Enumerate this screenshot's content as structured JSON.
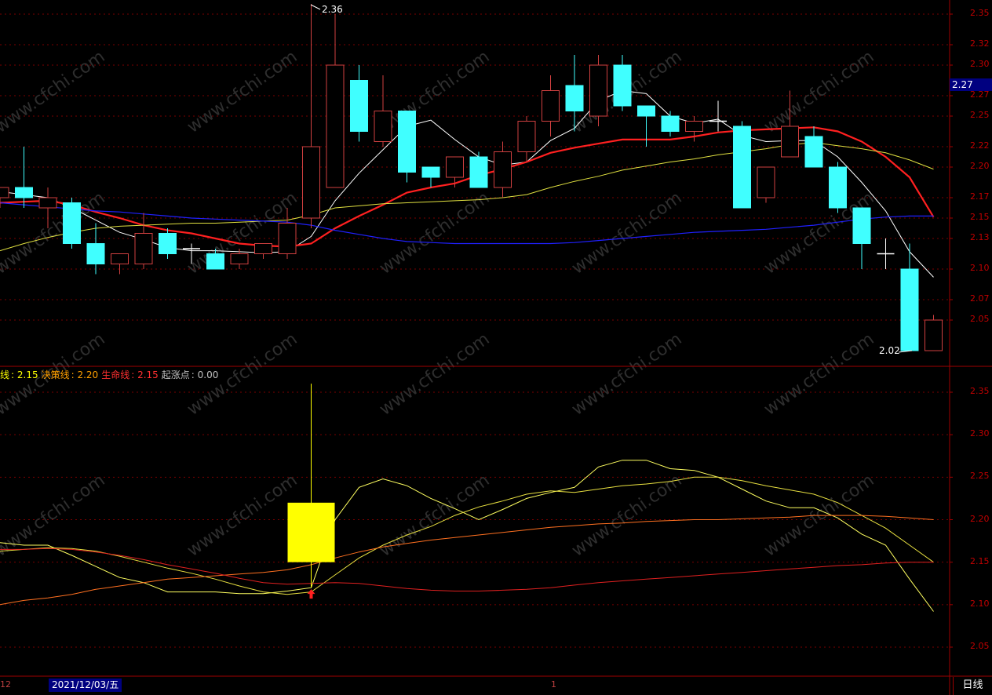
{
  "colors": {
    "background": "#000000",
    "grid": "#7a0000",
    "axis_text": "#c00000",
    "up_candle": "#d04040",
    "down_candle": "#40ffff",
    "ma_fast": "#ffffff",
    "ma_mid": "#ff2020",
    "ma_slow": "#e0e040",
    "ma_long": "#2020ff",
    "signal_box": "#ffff00",
    "arrow": "#ff2020"
  },
  "main_panel": {
    "y_ticks": [
      "2.35",
      "2.32",
      "2.30",
      "2.27",
      "2.25",
      "2.22",
      "2.20",
      "2.17",
      "2.15",
      "2.13",
      "2.10",
      "2.07",
      "2.05"
    ],
    "current_price": "2.27",
    "high_label": "2.36",
    "low_label": "2.02"
  },
  "indicator_panel": {
    "legend": [
      {
        "name": "线",
        "value": "2.15",
        "color": "#ffff00"
      },
      {
        "name": "决策线",
        "value": "2.20",
        "color": "#ffa000"
      },
      {
        "name": "生命线",
        "value": "2.15",
        "color": "#ff3030"
      },
      {
        "name": "起涨点",
        "value": "0.00",
        "color": "#c0c0c0"
      }
    ],
    "y_ticks": [
      "2.35",
      "2.30",
      "2.25",
      "2.20",
      "2.15",
      "2.10",
      "2.05"
    ]
  },
  "x_axis": {
    "left_fragment": "12",
    "cursor_date": "2021/12/03/五",
    "month_marker": "1",
    "period": "日线"
  },
  "watermark": "www.cfchi.com",
  "chart_data": {
    "type": "candlestick",
    "ylim": [
      2.025,
      2.375
    ],
    "candles": [
      {
        "o": 2.17,
        "c": 2.18,
        "h": 2.18,
        "l": 2.16
      },
      {
        "o": 2.18,
        "c": 2.17,
        "h": 2.22,
        "l": 2.16
      },
      {
        "o": 2.16,
        "c": 2.17,
        "h": 2.18,
        "l": 2.14
      },
      {
        "o": 2.165,
        "c": 2.125,
        "h": 2.17,
        "l": 2.12
      },
      {
        "o": 2.125,
        "c": 2.105,
        "h": 2.145,
        "l": 2.095
      },
      {
        "o": 2.105,
        "c": 2.115,
        "h": 2.115,
        "l": 2.095
      },
      {
        "o": 2.105,
        "c": 2.135,
        "h": 2.155,
        "l": 2.1
      },
      {
        "o": 2.135,
        "c": 2.115,
        "h": 2.14,
        "l": 2.11
      },
      {
        "o": 2.12,
        "c": 2.12,
        "h": 2.125,
        "l": 2.105
      },
      {
        "o": 2.115,
        "c": 2.1,
        "h": 2.12,
        "l": 2.1
      },
      {
        "o": 2.105,
        "c": 2.115,
        "h": 2.12,
        "l": 2.1
      },
      {
        "o": 2.115,
        "c": 2.125,
        "h": 2.125,
        "l": 2.11
      },
      {
        "o": 2.115,
        "c": 2.145,
        "h": 2.16,
        "l": 2.11
      },
      {
        "o": 2.15,
        "c": 2.22,
        "h": 2.36,
        "l": 2.14
      },
      {
        "o": 2.18,
        "c": 2.3,
        "h": 2.35,
        "l": 2.18
      },
      {
        "o": 2.285,
        "c": 2.235,
        "h": 2.3,
        "l": 2.225
      },
      {
        "o": 2.225,
        "c": 2.255,
        "h": 2.29,
        "l": 2.22
      },
      {
        "o": 2.255,
        "c": 2.195,
        "h": 2.255,
        "l": 2.185
      },
      {
        "o": 2.2,
        "c": 2.19,
        "h": 2.2,
        "l": 2.18
      },
      {
        "o": 2.19,
        "c": 2.21,
        "h": 2.21,
        "l": 2.18
      },
      {
        "o": 2.21,
        "c": 2.18,
        "h": 2.215,
        "l": 2.18
      },
      {
        "o": 2.18,
        "c": 2.215,
        "h": 2.225,
        "l": 2.17
      },
      {
        "o": 2.215,
        "c": 2.245,
        "h": 2.25,
        "l": 2.205
      },
      {
        "o": 2.245,
        "c": 2.275,
        "h": 2.29,
        "l": 2.23
      },
      {
        "o": 2.28,
        "c": 2.255,
        "h": 2.31,
        "l": 2.235
      },
      {
        "o": 2.25,
        "c": 2.3,
        "h": 2.31,
        "l": 2.24
      },
      {
        "o": 2.3,
        "c": 2.26,
        "h": 2.31,
        "l": 2.255
      },
      {
        "o": 2.26,
        "c": 2.25,
        "h": 2.26,
        "l": 2.22
      },
      {
        "o": 2.25,
        "c": 2.235,
        "h": 2.255,
        "l": 2.23
      },
      {
        "o": 2.235,
        "c": 2.245,
        "h": 2.25,
        "l": 2.225
      },
      {
        "o": 2.245,
        "c": 2.245,
        "h": 2.265,
        "l": 2.235
      },
      {
        "o": 2.24,
        "c": 2.16,
        "h": 2.245,
        "l": 2.16
      },
      {
        "o": 2.17,
        "c": 2.2,
        "h": 2.2,
        "l": 2.165
      },
      {
        "o": 2.21,
        "c": 2.24,
        "h": 2.275,
        "l": 2.21
      },
      {
        "o": 2.23,
        "c": 2.2,
        "h": 2.24,
        "l": 2.2
      },
      {
        "o": 2.2,
        "c": 2.16,
        "h": 2.205,
        "l": 2.155
      },
      {
        "o": 2.16,
        "c": 2.125,
        "h": 2.16,
        "l": 2.1
      },
      {
        "o": 2.115,
        "c": 2.115,
        "h": 2.13,
        "l": 2.1
      },
      {
        "o": 2.1,
        "c": 2.02,
        "h": 2.125,
        "l": 2.02
      },
      {
        "o": 2.02,
        "c": 2.05,
        "h": 2.055,
        "l": 2.02
      }
    ],
    "series": [
      {
        "name": "MA5",
        "values": [
          2.176,
          2.173,
          2.17,
          2.16,
          2.148,
          2.136,
          2.129,
          2.121,
          2.118,
          2.118,
          2.117,
          2.116,
          2.117,
          2.132,
          2.167,
          2.194,
          2.217,
          2.24,
          2.246,
          2.227,
          2.21,
          2.202,
          2.205,
          2.226,
          2.238,
          2.265,
          2.275,
          2.272,
          2.25,
          2.243,
          2.247,
          2.231,
          2.225,
          2.226,
          2.226,
          2.21,
          2.185,
          2.157,
          2.117,
          2.092
        ]
      },
      {
        "name": "MA10",
        "values": [
          2.165,
          2.166,
          2.167,
          2.163,
          2.156,
          2.15,
          2.143,
          2.138,
          2.135,
          2.13,
          2.125,
          2.123,
          2.122,
          2.125,
          2.14,
          2.152,
          2.163,
          2.175,
          2.18,
          2.184,
          2.192,
          2.198,
          2.205,
          2.214,
          2.219,
          2.223,
          2.227,
          2.227,
          2.227,
          2.23,
          2.234,
          2.236,
          2.237,
          2.238,
          2.239,
          2.235,
          2.225,
          2.21,
          2.19,
          2.151
        ]
      },
      {
        "name": "MA20",
        "values": [
          2.118,
          2.125,
          2.131,
          2.136,
          2.14,
          2.142,
          2.143,
          2.144,
          2.145,
          2.145,
          2.146,
          2.147,
          2.148,
          2.153,
          2.16,
          2.162,
          2.164,
          2.165,
          2.166,
          2.167,
          2.168,
          2.17,
          2.173,
          2.18,
          2.186,
          2.191,
          2.197,
          2.201,
          2.205,
          2.208,
          2.212,
          2.215,
          2.218,
          2.222,
          2.224,
          2.221,
          2.218,
          2.214,
          2.207,
          2.198
        ]
      },
      {
        "name": "MA60",
        "values": [
          2.165,
          2.163,
          2.161,
          2.159,
          2.157,
          2.156,
          2.154,
          2.152,
          2.15,
          2.149,
          2.148,
          2.147,
          2.146,
          2.143,
          2.138,
          2.134,
          2.13,
          2.127,
          2.126,
          2.125,
          2.125,
          2.125,
          2.125,
          2.125,
          2.126,
          2.128,
          2.13,
          2.132,
          2.134,
          2.136,
          2.137,
          2.138,
          2.139,
          2.141,
          2.143,
          2.146,
          2.149,
          2.151,
          2.152,
          2.152
        ]
      }
    ],
    "indicator": {
      "ylim": [
        2.025,
        2.38
      ],
      "signal_index": 13,
      "signal_box": {
        "top": 2.22,
        "bottom": 2.15,
        "high": 2.36,
        "low": 2.12
      },
      "series": [
        {
          "values": [
            2.173,
            2.17,
            2.17,
            2.158,
            2.145,
            2.132,
            2.126,
            2.115,
            2.115,
            2.115,
            2.113,
            2.113,
            2.116,
            2.12,
            2.2,
            2.238,
            2.248,
            2.24,
            2.225,
            2.213,
            2.2,
            2.212,
            2.225,
            2.232,
            2.238,
            2.262,
            2.27,
            2.27,
            2.26,
            2.258,
            2.25,
            2.236,
            2.222,
            2.214,
            2.214,
            2.202,
            2.183,
            2.17,
            2.13,
            2.092
          ]
        },
        {
          "values": [
            2.163,
            2.165,
            2.167,
            2.166,
            2.163,
            2.157,
            2.15,
            2.143,
            2.137,
            2.13,
            2.122,
            2.115,
            2.112,
            2.115,
            2.135,
            2.155,
            2.17,
            2.182,
            2.192,
            2.205,
            2.215,
            2.222,
            2.23,
            2.234,
            2.232,
            2.236,
            2.24,
            2.242,
            2.245,
            2.25,
            2.25,
            2.246,
            2.24,
            2.235,
            2.23,
            2.22,
            2.205,
            2.19,
            2.17,
            2.15
          ]
        },
        {
          "values": [
            2.1,
            2.105,
            2.108,
            2.112,
            2.118,
            2.122,
            2.126,
            2.13,
            2.132,
            2.134,
            2.136,
            2.138,
            2.141,
            2.147,
            2.155,
            2.162,
            2.168,
            2.172,
            2.176,
            2.179,
            2.182,
            2.185,
            2.188,
            2.191,
            2.193,
            2.195,
            2.196,
            2.198,
            2.199,
            2.2,
            2.2,
            2.201,
            2.202,
            2.203,
            2.205,
            2.205,
            2.205,
            2.204,
            2.202,
            2.2
          ]
        },
        {
          "values": [
            2.165,
            2.165,
            2.166,
            2.165,
            2.162,
            2.158,
            2.153,
            2.147,
            2.142,
            2.137,
            2.131,
            2.126,
            2.124,
            2.125,
            2.126,
            2.125,
            2.122,
            2.119,
            2.117,
            2.116,
            2.116,
            2.117,
            2.118,
            2.12,
            2.123,
            2.126,
            2.128,
            2.13,
            2.132,
            2.134,
            2.136,
            2.138,
            2.14,
            2.142,
            2.144,
            2.146,
            2.147,
            2.149,
            2.15,
            2.15
          ]
        }
      ]
    }
  }
}
